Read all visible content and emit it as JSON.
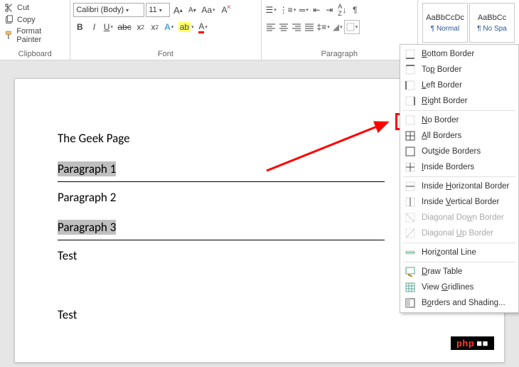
{
  "clipboard": {
    "cut": "Cut",
    "copy": "Copy",
    "format_painter": "Format Painter",
    "group_label": "Clipboard"
  },
  "font": {
    "name": "Calibri (Body)",
    "size": "11",
    "group_label": "Font"
  },
  "paragraph": {
    "group_label": "Paragraph"
  },
  "styles": {
    "preview": "AaBbCcDc",
    "normal": "¶ Normal",
    "preview2": "AaBbCc",
    "nospacing": "¶ No Spa"
  },
  "border_menu": {
    "bottom": "Bottom Border",
    "top": "Top Border",
    "left": "Left Border",
    "right": "Right Border",
    "none": "No Border",
    "all": "All Borders",
    "outside": "Outside Borders",
    "inside": "Inside Borders",
    "inside_h": "Inside Horizontal Border",
    "inside_v": "Inside Vertical Border",
    "diag_down": "Diagonal Down Border",
    "diag_up": "Diagonal Up Border",
    "hline": "Horizontal Line",
    "draw": "Draw Table",
    "gridlines": "View Gridlines",
    "shading": "Borders and Shading..."
  },
  "document": {
    "title": "The Geek Page",
    "p1": "Paragraph 1",
    "p2": "Paragraph 2",
    "p3": "Paragraph 3",
    "test1": "Test",
    "test2": "Test"
  },
  "watermark": {
    "p1": "php",
    "p2": "■■"
  }
}
